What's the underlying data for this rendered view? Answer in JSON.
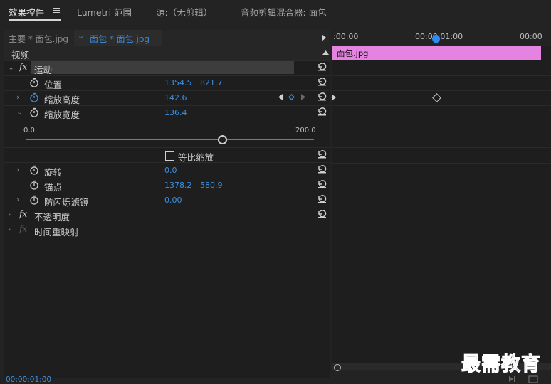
{
  "tabs": [
    {
      "label": "效果控件"
    },
    {
      "label": "Lumetri 范围"
    },
    {
      "label": "源:（无剪辑）"
    },
    {
      "label": "音频剪辑混合器: 面包"
    }
  ],
  "source_bar": {
    "main_label": "主要 * 面包.jpg",
    "clip_label": "面包 * 面包.jpg"
  },
  "sections": {
    "video": "视频",
    "motion": "运动",
    "opacity": "不透明度",
    "time_remap": "时间重映射"
  },
  "properties": {
    "position": {
      "label": "位置",
      "x": "1354.5",
      "y": "821.7"
    },
    "scale_height": {
      "label": "缩放高度",
      "value": "142.6"
    },
    "scale_width": {
      "label": "缩放宽度",
      "value": "136.4"
    },
    "slider": {
      "min": "0.0",
      "max": "200.0",
      "value": 136.4
    },
    "uniform_scale": {
      "label": "等比缩放",
      "checked": false
    },
    "rotation": {
      "label": "旋转",
      "value": "0.0"
    },
    "anchor": {
      "label": "锚点",
      "x": "1378.2",
      "y": "580.9"
    },
    "anti_flicker": {
      "label": "防闪烁滤镜",
      "value": "0.00"
    }
  },
  "timeline": {
    "ruler": [
      ":00:00",
      "00:00:01:00",
      "00:00"
    ],
    "clip_name": "面包.jpg",
    "playhead_time": "00:00:01:00"
  },
  "footer": {
    "timecode": "00:00:01:00",
    "watermark": "最需教育"
  },
  "colors": {
    "accent_blue": "#2d8cf0",
    "clip_pink": "#e483e0",
    "value_blue": "#3d8fe0"
  }
}
